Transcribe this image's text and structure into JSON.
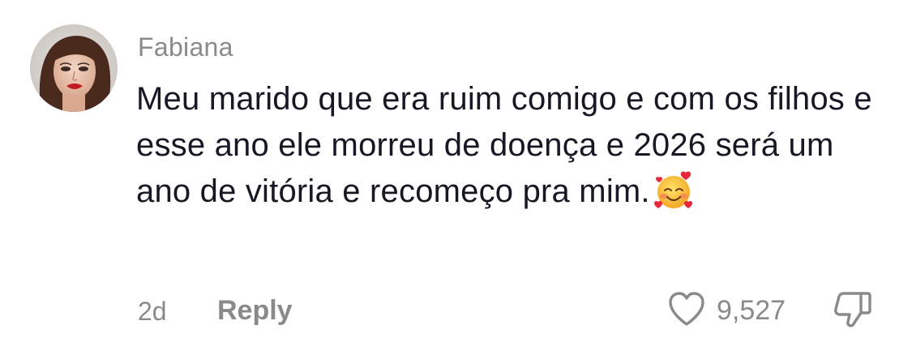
{
  "comment": {
    "username": "Fabiana",
    "text": "Meu marido que era ruim comigo e com os filhos e esse ano ele morreu de doença e 2026 será um ano de vitória e recomeço pra mim.",
    "emoji": "smiling-face-with-hearts",
    "time": "2d",
    "reply_label": "Reply",
    "like_count": "9,527"
  },
  "colors": {
    "text_primary": "#161823",
    "text_secondary": "#8a8a8a",
    "background": "#ffffff"
  },
  "icons": {
    "avatar": "profile-photo",
    "like": "heart-outline-icon",
    "dislike": "thumbs-down-outline-icon"
  }
}
